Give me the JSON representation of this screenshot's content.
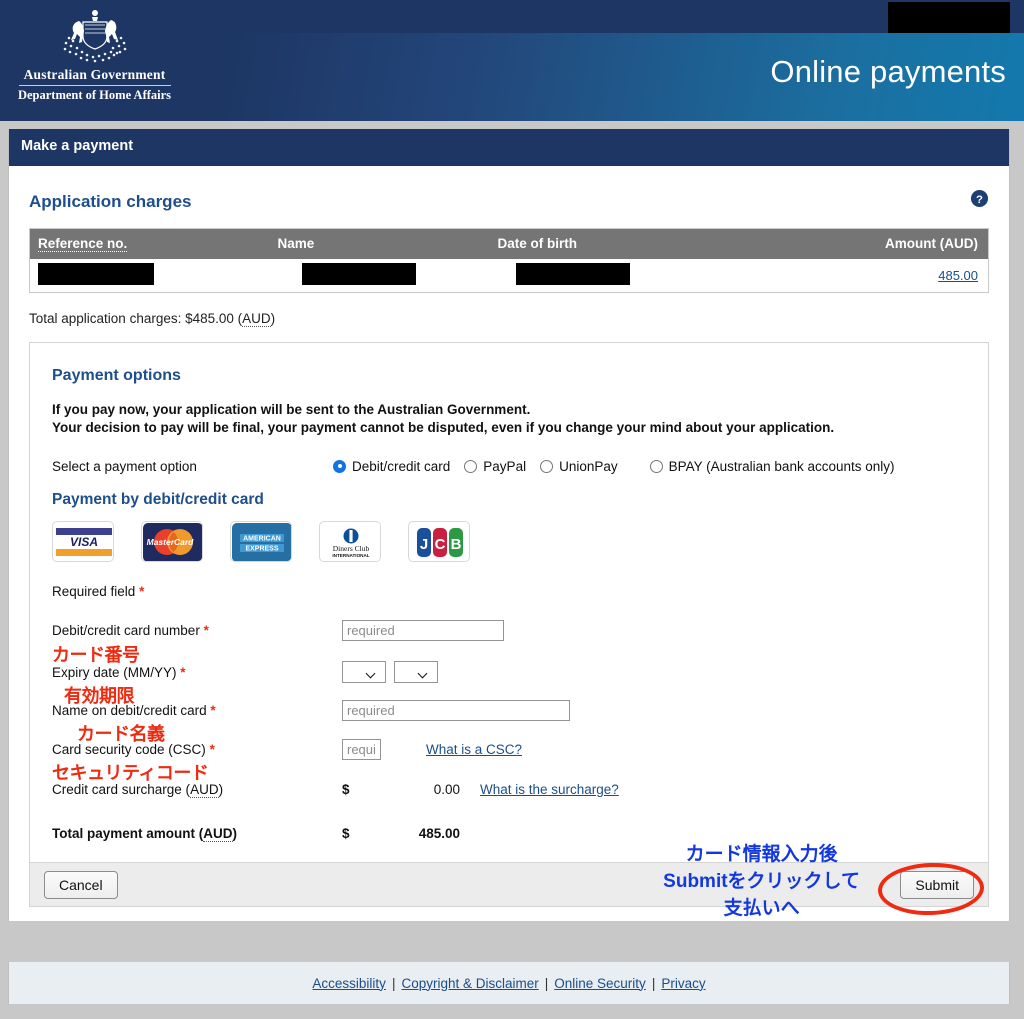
{
  "header": {
    "crest_line1": "Australian Government",
    "crest_line2": "Department of Home Affairs",
    "crest_icon": "australian-coat-of-arms",
    "title": "Online payments",
    "redaction": ""
  },
  "page": {
    "bar_title": "Make a payment",
    "charges_heading": "Application charges",
    "help_icon": "help-question-icon"
  },
  "charges_table": {
    "columns": [
      "Reference no.",
      "Name",
      "Date of birth",
      "Amount (AUD)"
    ],
    "rows": [
      {
        "reference_no": "",
        "name": "",
        "date_of_birth": "",
        "amount": "485.00"
      }
    ],
    "total_line": "Total application charges: $485.00 (AUD)"
  },
  "payment_options": {
    "heading": "Payment options",
    "notice_line1": "If you pay now, your application will be sent to the Australian Government.",
    "notice_line2": "Your decision to pay will be final, your payment cannot be disputed, even if you change your mind about your application.",
    "select_label": "Select a payment option",
    "options": [
      {
        "label": "Debit/credit card",
        "selected": true
      },
      {
        "label": "PayPal",
        "selected": false
      },
      {
        "label": "UnionPay",
        "selected": false
      },
      {
        "label": "BPAY (Australian bank accounts only)",
        "selected": false
      }
    ]
  },
  "card_section": {
    "heading": "Payment by debit/credit card",
    "logos": [
      "visa-logo",
      "mastercard-logo",
      "amex-logo",
      "diners-club-logo",
      "jcb-logo"
    ],
    "logo_labels": {
      "visa": "VISA",
      "mastercard": "MasterCard",
      "amex_line1": "AMERICAN",
      "amex_line2": "EXPRESS",
      "diners_line1": "Diners Club",
      "diners_line2": "INTERNATIONAL",
      "jcb": "JCB"
    },
    "required_field_note": "Required field",
    "fields": {
      "card_number_label": "Debit/credit card number",
      "card_number_placeholder": "required",
      "card_number_value": "",
      "expiry_label": "Expiry date (MM/YY)",
      "expiry_month_value": "",
      "expiry_year_value": "",
      "name_label": "Name on debit/credit card",
      "name_placeholder": "required",
      "name_value": "",
      "csc_label": "Card security code (CSC)",
      "csc_placeholder": "requir",
      "csc_value": "",
      "csc_link": "What is a CSC?",
      "surcharge_label": "Credit card surcharge (AUD)",
      "surcharge_symbol": "$",
      "surcharge_amount": "0.00",
      "surcharge_link": "What is the surcharge?",
      "total_label": "Total payment amount (AUD)",
      "total_symbol": "$",
      "total_amount": "485.00"
    }
  },
  "annotations": {
    "card_number_jp": "カード番号",
    "expiry_jp": "有効期限",
    "name_jp": "カード名義",
    "csc_jp": "セキュリティコード",
    "submit_jp_line1": "カード情報入力後",
    "submit_jp_line2": "Submitをクリックして",
    "submit_jp_line3": "支払いへ",
    "highlight_shape": "red-ellipse-around-submit"
  },
  "buttons": {
    "cancel": "Cancel",
    "submit": "Submit"
  },
  "footer": {
    "links": [
      "Accessibility",
      "Copyright & Disclaimer",
      "Online Security",
      "Privacy"
    ],
    "separator": "|"
  },
  "colors": {
    "header_navy": "#1d3664",
    "header_teal": "#1379ad",
    "heading_blue": "#1f4e8c",
    "link_blue": "#1a4e8a",
    "table_header_gray": "#757575",
    "annotation_red": "#ee2a10",
    "annotation_blue": "#1338e0",
    "required_star": "#e03018"
  }
}
